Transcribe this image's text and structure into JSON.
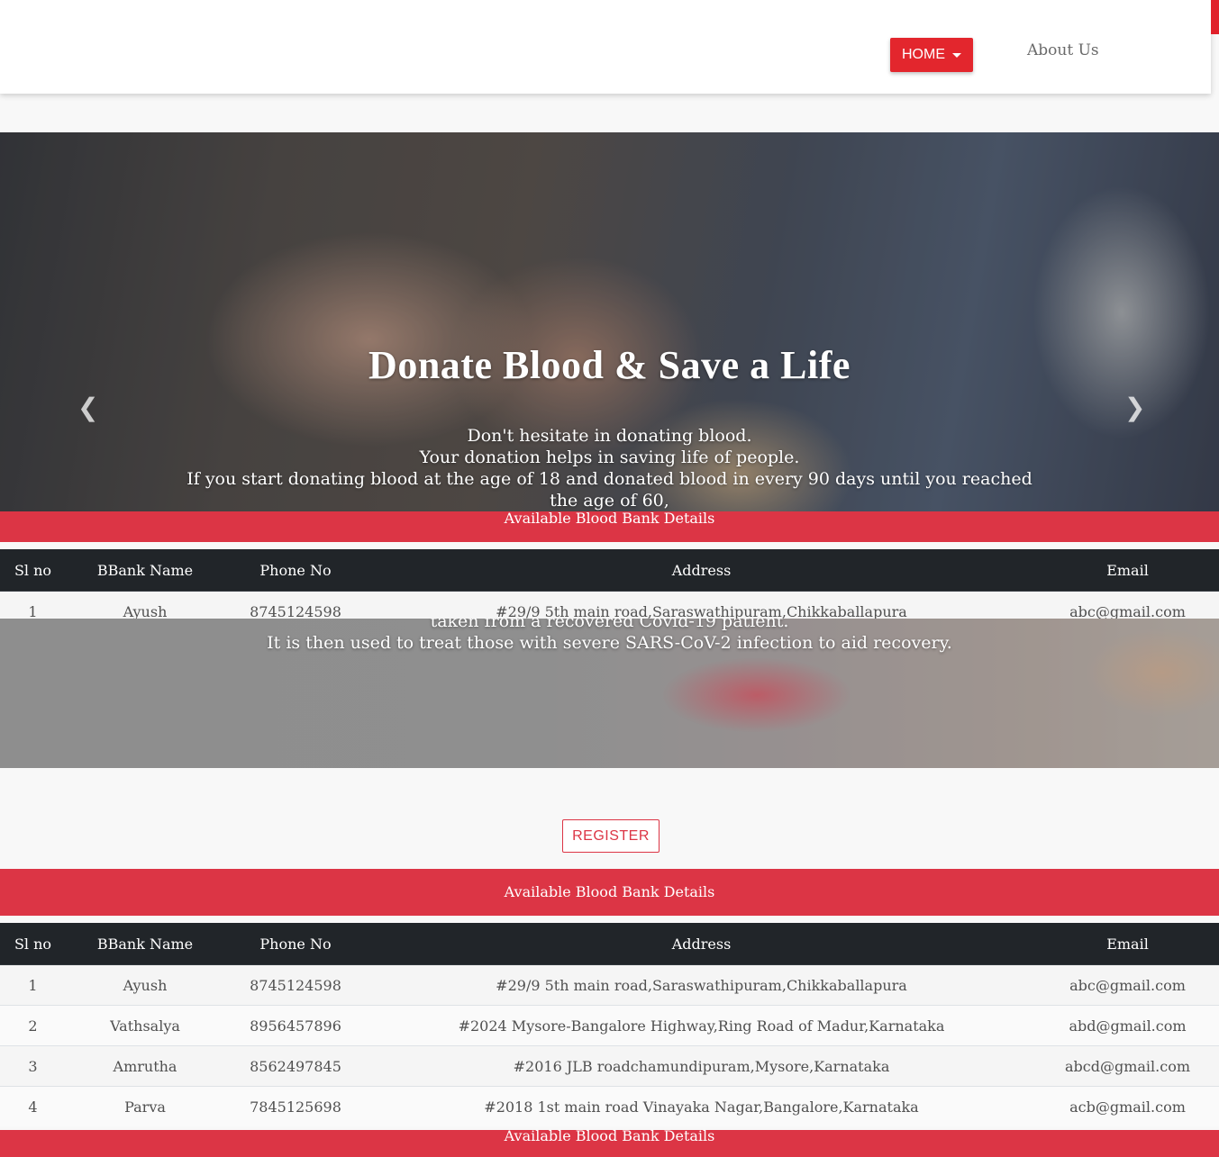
{
  "navbar": {
    "home_label": "HOME",
    "about_label": "About Us"
  },
  "carousel": {
    "title": "Donate Blood & Save a Life",
    "lines": [
      "Don't hesitate in donating blood.",
      "Your donation helps in saving life of people.",
      "If you start donating blood at the age of 18 and donated blood in every 90 days until you reached the age of 60,"
    ],
    "slide2_lines": [
      "taken from a recovered Covid-19 patient.",
      "It is then used to treat those with severe SARS-CoV-2 infection to aid recovery."
    ]
  },
  "register_label": "REGISTER",
  "blood_banks": {
    "heading": "Available Blood Bank Details",
    "columns": [
      "Sl no",
      "BBank Name",
      "Phone No",
      "Address",
      "Email"
    ],
    "rows": [
      [
        "1",
        "Ayush",
        "8745124598",
        "#29/9 5th main road,Saraswathipuram,Chikkaballapura",
        "abc@gmail.com"
      ],
      [
        "2",
        "Vathsalya",
        "8956457896",
        "#2024 Mysore-Bangalore Highway,Ring Road of Madur,Karnataka",
        "abd@gmail.com"
      ],
      [
        "3",
        "Amrutha",
        "8562497845",
        "#2016 JLB roadchamundipuram,Mysore,Karnataka",
        "abcd@gmail.com"
      ],
      [
        "4",
        "Parva",
        "7845125698",
        "#2018 1st main road Vinayaka Nagar,Bangalore,Karnataka",
        "acb@gmail.com"
      ]
    ]
  }
}
